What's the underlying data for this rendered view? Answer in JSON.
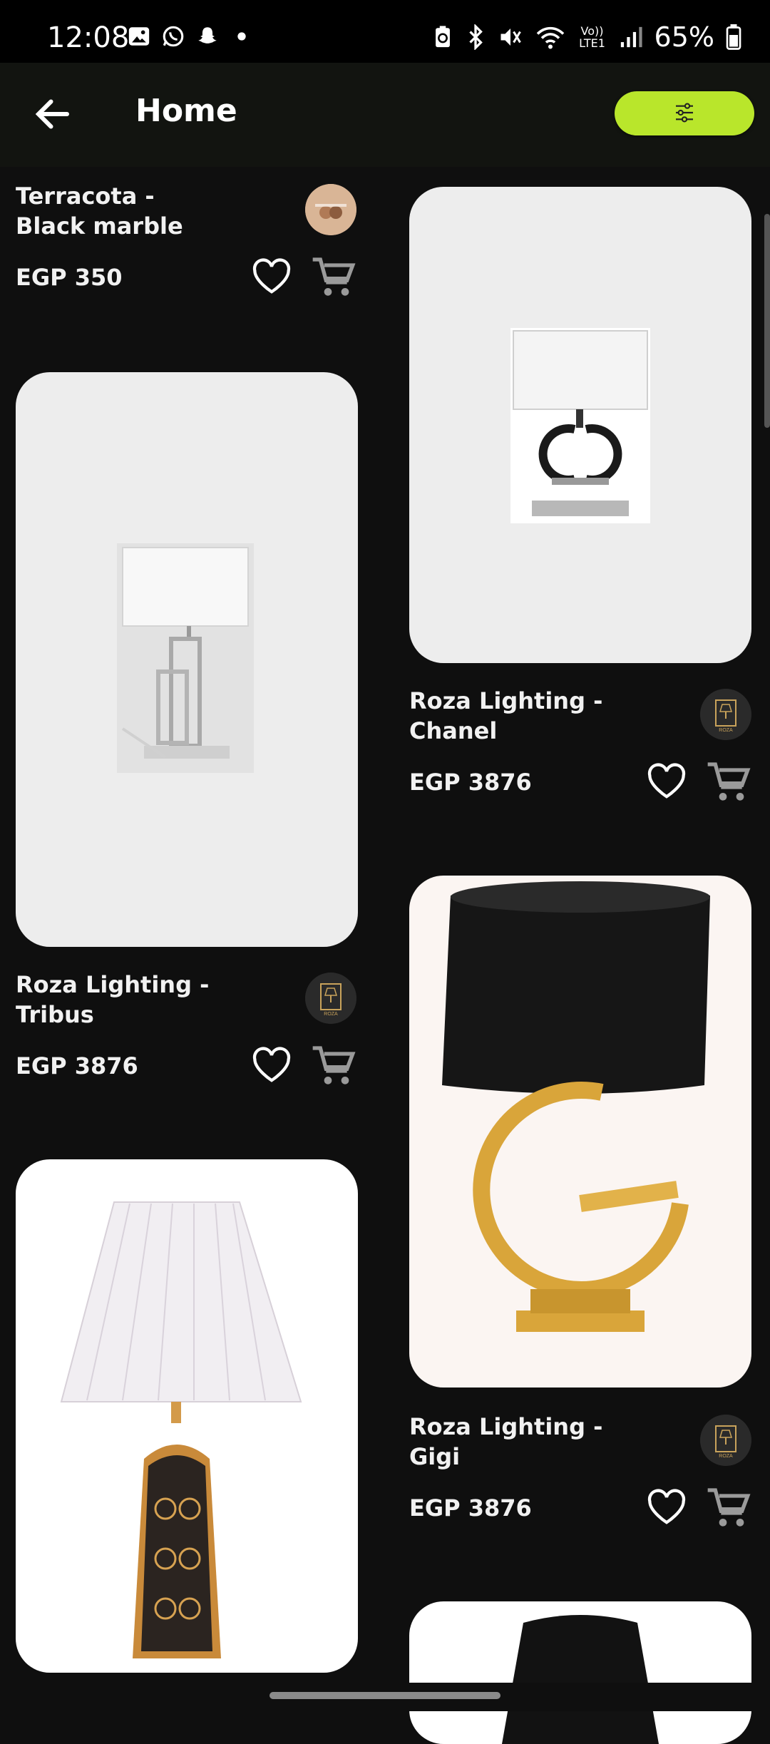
{
  "status_bar": {
    "time": "12:08",
    "battery": "65%",
    "left_icons": [
      "gallery-icon",
      "whatsapp-icon",
      "snapchat-icon",
      "dot-icon"
    ],
    "right_icons": [
      "battery-saver-icon",
      "bluetooth-icon",
      "mute-icon",
      "wifi-icon",
      "volte-icon",
      "signal-icon",
      "battery-icon"
    ],
    "volte_label": "Vo)) LTE1"
  },
  "app_bar": {
    "title": "Home",
    "back_icon": "back-arrow-icon",
    "filter_icon": "sliders-icon",
    "accent_color": "#b9e62b"
  },
  "products": [
    {
      "name": "Terracota - Black marble",
      "price": "EGP 350",
      "brand": "Terracota"
    },
    {
      "name": "Roza Lighting - Chanel",
      "price": "EGP 3876",
      "brand": "Roza Lighting"
    },
    {
      "name": "Roza Lighting - Tribus",
      "price": "EGP 3876",
      "brand": "Roza Lighting"
    },
    {
      "name": "Roza Lighting - Gigi",
      "price": "EGP 3876",
      "brand": "Roza Lighting"
    },
    {
      "name": "",
      "price": "",
      "brand": ""
    },
    {
      "name": "",
      "price": "",
      "brand": ""
    }
  ],
  "brand_logo_text": {
    "roza": "ROZA LIGHTING",
    "terracota": "Terracota"
  }
}
